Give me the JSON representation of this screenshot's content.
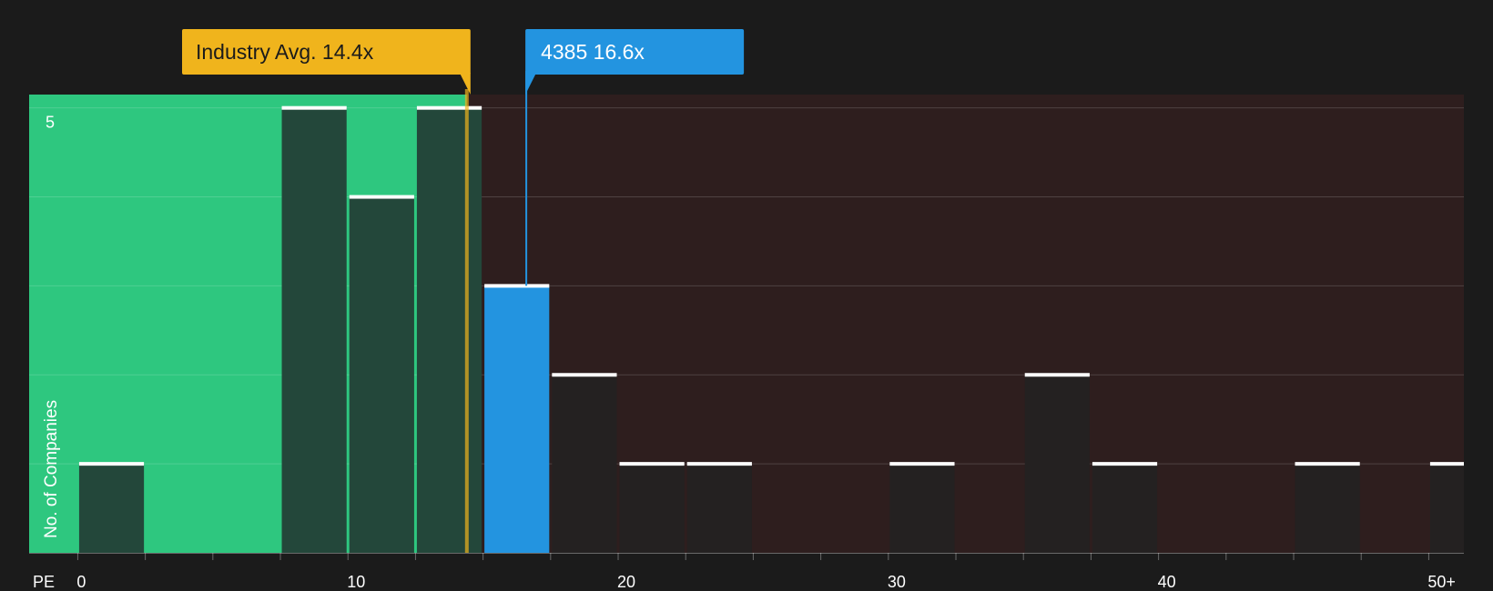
{
  "chart_data": {
    "type": "bar",
    "x_axis_label": "PE",
    "y_axis_label": "No. of Companies",
    "x_ticks": [
      {
        "value": 0,
        "label": "0"
      },
      {
        "value": 10,
        "label": "10"
      },
      {
        "value": 20,
        "label": "20"
      },
      {
        "value": 30,
        "label": "30"
      },
      {
        "value": 40,
        "label": "40"
      },
      {
        "value": 50,
        "label": "50+"
      }
    ],
    "y_ticks": [
      {
        "value": 5,
        "label": "5"
      }
    ],
    "xlim": [
      -1.8,
      51.3
    ],
    "ylim": [
      0,
      5.15
    ],
    "bins": [
      {
        "x0": 0,
        "x1": 2.5,
        "count": 1
      },
      {
        "x0": 7.5,
        "x1": 10,
        "count": 5
      },
      {
        "x0": 10,
        "x1": 12.5,
        "count": 4
      },
      {
        "x0": 12.5,
        "x1": 15,
        "count": 5
      },
      {
        "x0": 15,
        "x1": 17.5,
        "count": 3,
        "highlight": true
      },
      {
        "x0": 17.5,
        "x1": 20,
        "count": 2
      },
      {
        "x0": 20,
        "x1": 22.5,
        "count": 1
      },
      {
        "x0": 22.5,
        "x1": 25,
        "count": 1
      },
      {
        "x0": 30,
        "x1": 32.5,
        "count": 1
      },
      {
        "x0": 35,
        "x1": 37.5,
        "count": 2
      },
      {
        "x0": 37.5,
        "x1": 40,
        "count": 1
      },
      {
        "x0": 45,
        "x1": 47.5,
        "count": 1
      },
      {
        "x0": 50,
        "x1": 52.5,
        "count": 1
      }
    ],
    "industry_average": {
      "value": 14.4,
      "label": "Industry Avg. 14.4x"
    },
    "company": {
      "value": 16.6,
      "label": "4385 16.6x"
    },
    "colors": {
      "background": "#1b1b1b",
      "good_region": "#2ec77f",
      "bad_region": "#2e1e1e",
      "bar": "#242121",
      "bar_in_good": "#23473a",
      "highlight_bar": "#2394e0",
      "industry_marker": "#f0b41c",
      "company_marker": "#2394e0",
      "bar_cap": "#ffffff"
    }
  }
}
